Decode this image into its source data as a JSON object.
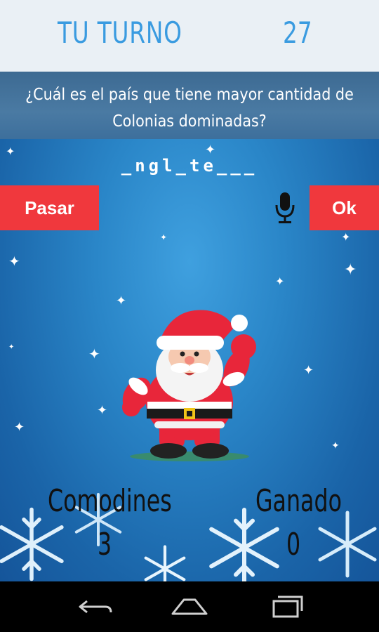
{
  "header": {
    "turn_label": "TU TURNO",
    "timer": "27"
  },
  "question": {
    "text": "¿Cuál es el país que tiene mayor cantidad de Colonias dominadas?"
  },
  "hint": {
    "pattern": "_ngl_te___"
  },
  "actions": {
    "pass_label": "Pasar",
    "ok_label": "Ok",
    "mic_icon": "microphone-icon"
  },
  "stats": {
    "wildcards_label": "Comodines",
    "wildcards_value": "3",
    "won_label": "Ganado",
    "won_value": "0"
  },
  "colors": {
    "accent_blue": "#3a9be0",
    "button_red": "#f0383d",
    "bg_blue": "#2a86c8"
  },
  "navigation": {
    "back_icon": "back-icon",
    "home_icon": "home-icon",
    "recents_icon": "recents-icon"
  }
}
